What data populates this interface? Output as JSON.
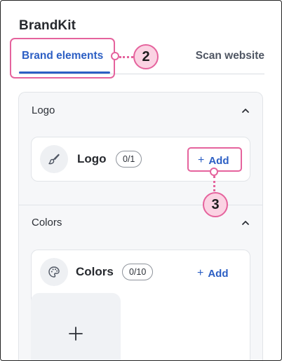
{
  "app": {
    "title": "BrandKit"
  },
  "tabs": [
    {
      "label": "Brand elements",
      "active": true
    },
    {
      "label": "Scan website",
      "active": false
    }
  ],
  "callouts": [
    {
      "number": "2"
    },
    {
      "number": "3"
    }
  ],
  "sections": {
    "logo": {
      "header": "Logo",
      "card": {
        "title": "Logo",
        "count": "0/1",
        "add_label": "Add",
        "icon": "brush-icon"
      }
    },
    "colors": {
      "header": "Colors",
      "card": {
        "title": "Colors",
        "count": "0/10",
        "add_label": "Add",
        "icon": "palette-icon"
      }
    }
  },
  "colors": {
    "accent": "#2c5fc4",
    "callout": "#e5639d",
    "callout_fill": "#fbd3e3"
  }
}
